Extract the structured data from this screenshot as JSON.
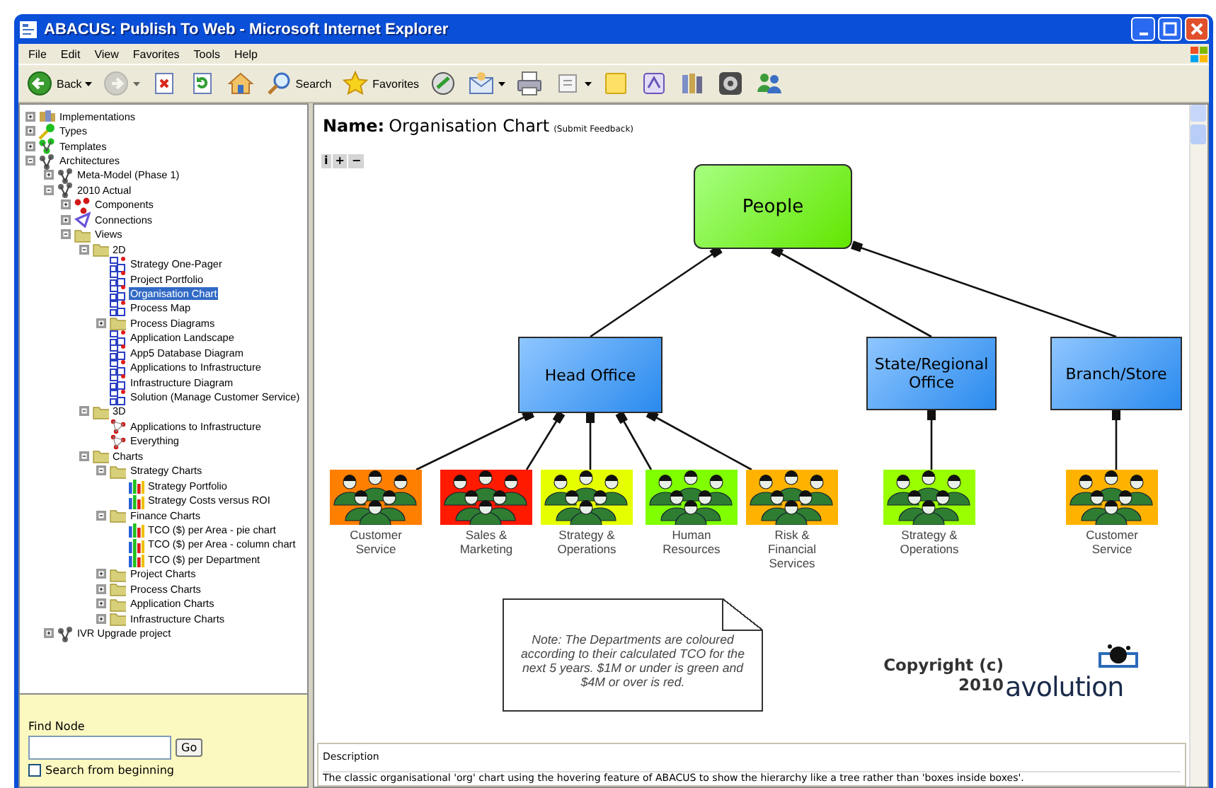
{
  "window": {
    "title": "ABACUS: Publish To Web - Microsoft Internet Explorer"
  },
  "menu": [
    "File",
    "Edit",
    "View",
    "Favorites",
    "Tools",
    "Help"
  ],
  "toolbar": [
    {
      "kind": "back",
      "label": "Back",
      "dropdown": true,
      "disabled": false
    },
    {
      "kind": "forward",
      "dropdown": true,
      "disabled": true
    },
    {
      "kind": "stop",
      "dropdown": false,
      "disabled": false
    },
    {
      "kind": "refresh",
      "dropdown": false,
      "disabled": false
    },
    {
      "kind": "home",
      "dropdown": false,
      "disabled": false
    },
    {
      "kind": "search",
      "label": "Search",
      "dropdown": false,
      "disabled": false
    },
    {
      "kind": "favorites",
      "label": "Favorites",
      "dropdown": false,
      "disabled": false
    },
    {
      "kind": "media",
      "dropdown": false,
      "disabled": false
    },
    {
      "kind": "mail",
      "dropdown": true,
      "disabled": false
    },
    {
      "kind": "print",
      "dropdown": false,
      "disabled": false
    },
    {
      "kind": "edit",
      "dropdown": true,
      "disabled": false
    },
    {
      "kind": "note",
      "dropdown": false,
      "disabled": false
    },
    {
      "kind": "research",
      "dropdown": false,
      "disabled": false
    },
    {
      "kind": "library",
      "dropdown": false,
      "disabled": false
    },
    {
      "kind": "disc",
      "dropdown": false,
      "disabled": false
    },
    {
      "kind": "messenger",
      "dropdown": false,
      "disabled": false
    }
  ],
  "tree": [
    {
      "label": "Implementations",
      "kind": "implementations",
      "expandable": true,
      "expanded": false,
      "selected": false
    },
    {
      "label": "Types",
      "kind": "types",
      "expandable": true,
      "expanded": false,
      "selected": false
    },
    {
      "label": "Templates",
      "kind": "templates",
      "expandable": true,
      "expanded": false,
      "selected": false
    },
    {
      "label": "Architectures",
      "kind": "architecture",
      "expandable": true,
      "expanded": true,
      "selected": false,
      "children": [
        {
          "label": "Meta-Model (Phase 1)",
          "kind": "architecture",
          "expandable": true,
          "expanded": false,
          "selected": false
        },
        {
          "label": "2010 Actual",
          "kind": "architecture",
          "expandable": true,
          "expanded": true,
          "selected": false,
          "children": [
            {
              "label": "Components",
              "kind": "components",
              "expandable": true,
              "expanded": false,
              "selected": false
            },
            {
              "label": "Connections",
              "kind": "connections",
              "expandable": true,
              "expanded": false,
              "selected": false
            },
            {
              "label": "Views",
              "kind": "folder",
              "expandable": true,
              "expanded": true,
              "selected": false,
              "children": [
                {
                  "label": "2D",
                  "kind": "folder",
                  "expandable": true,
                  "expanded": true,
                  "selected": false,
                  "children": [
                    {
                      "label": "Strategy One-Pager",
                      "kind": "view",
                      "expandable": false,
                      "expanded": false,
                      "selected": false
                    },
                    {
                      "label": "Project Portfolio",
                      "kind": "view",
                      "expandable": false,
                      "expanded": false,
                      "selected": false
                    },
                    {
                      "label": "Organisation Chart",
                      "kind": "view",
                      "expandable": false,
                      "expanded": false,
                      "selected": true
                    },
                    {
                      "label": "Process Map",
                      "kind": "view",
                      "expandable": false,
                      "expanded": false,
                      "selected": false
                    },
                    {
                      "label": "Process Diagrams",
                      "kind": "folder",
                      "expandable": true,
                      "expanded": false,
                      "selected": false
                    },
                    {
                      "label": "Application Landscape",
                      "kind": "view",
                      "expandable": false,
                      "expanded": false,
                      "selected": false
                    },
                    {
                      "label": "App5 Database Diagram",
                      "kind": "view",
                      "expandable": false,
                      "expanded": false,
                      "selected": false
                    },
                    {
                      "label": "Applications to Infrastructure",
                      "kind": "view",
                      "expandable": false,
                      "expanded": false,
                      "selected": false
                    },
                    {
                      "label": "Infrastructure Diagram",
                      "kind": "view",
                      "expandable": false,
                      "expanded": false,
                      "selected": false
                    },
                    {
                      "label": "Solution (Manage Customer Service)",
                      "kind": "view",
                      "expandable": false,
                      "expanded": false,
                      "selected": false
                    }
                  ]
                },
                {
                  "label": "3D",
                  "kind": "folder",
                  "expandable": true,
                  "expanded": true,
                  "selected": false,
                  "children": [
                    {
                      "label": "Applications to Infrastructure",
                      "kind": "view3d",
                      "expandable": false,
                      "expanded": false,
                      "selected": false
                    },
                    {
                      "label": "Everything",
                      "kind": "view3d",
                      "expandable": false,
                      "expanded": false,
                      "selected": false
                    }
                  ]
                },
                {
                  "label": "Charts",
                  "kind": "folder",
                  "expandable": true,
                  "expanded": true,
                  "selected": false,
                  "children": [
                    {
                      "label": "Strategy Charts",
                      "kind": "folder",
                      "expandable": true,
                      "expanded": true,
                      "selected": false,
                      "children": [
                        {
                          "label": "Strategy Portfolio",
                          "kind": "chart",
                          "expandable": false,
                          "expanded": false,
                          "selected": false
                        },
                        {
                          "label": "Strategy Costs versus ROI",
                          "kind": "chart",
                          "expandable": false,
                          "expanded": false,
                          "selected": false
                        }
                      ]
                    },
                    {
                      "label": "Finance Charts",
                      "kind": "folder",
                      "expandable": true,
                      "expanded": true,
                      "selected": false,
                      "children": [
                        {
                          "label": "TCO ($) per Area - pie chart",
                          "kind": "chart",
                          "expandable": false,
                          "expanded": false,
                          "selected": false
                        },
                        {
                          "label": "TCO ($) per Area - column chart",
                          "kind": "chart",
                          "expandable": false,
                          "expanded": false,
                          "selected": false
                        },
                        {
                          "label": "TCO ($) per Department",
                          "kind": "chart",
                          "expandable": false,
                          "expanded": false,
                          "selected": false
                        }
                      ]
                    },
                    {
                      "label": "Project Charts",
                      "kind": "folder",
                      "expandable": true,
                      "expanded": false,
                      "selected": false
                    },
                    {
                      "label": "Process Charts",
                      "kind": "folder",
                      "expandable": true,
                      "expanded": false,
                      "selected": false
                    },
                    {
                      "label": "Application Charts",
                      "kind": "folder",
                      "expandable": true,
                      "expanded": false,
                      "selected": false
                    },
                    {
                      "label": "Infrastructure Charts",
                      "kind": "folder",
                      "expandable": true,
                      "expanded": false,
                      "selected": false
                    }
                  ]
                }
              ]
            }
          ]
        },
        {
          "label": "IVR Upgrade project",
          "kind": "architecture",
          "expandable": true,
          "expanded": false,
          "selected": false
        }
      ]
    }
  ],
  "find_node": {
    "label": "Find Node",
    "button": "Go",
    "checkbox_label": "Search from beginning",
    "checked": false
  },
  "header": {
    "label": "Name:",
    "value": "Organisation Chart",
    "feedback_link": "(Submit Feedback)"
  },
  "zoom_buttons": [
    "i",
    "+",
    "−"
  ],
  "diagram": {
    "root": {
      "label": "People",
      "children": [
        {
          "label": "Head Office",
          "children": [
            {
              "label": "Customer Service",
              "color": "#ff7f00"
            },
            {
              "label": "Sales & Marketing",
              "color": "#ff1a00"
            },
            {
              "label": "Strategy & Operations",
              "color": "#e6ff00"
            },
            {
              "label": "Human Resources",
              "color": "#7fff00"
            },
            {
              "label": "Risk & Financial Services",
              "color": "#ffb300"
            }
          ]
        },
        {
          "label": "State/Regional Office",
          "children": [
            {
              "label": "Strategy & Operations",
              "color": "#99ff00"
            }
          ]
        },
        {
          "label": "Branch/Store",
          "children": [
            {
              "label": "Customer Service",
              "color": "#ffb300"
            }
          ]
        }
      ]
    },
    "note": "Note: The Departments are coloured according to their calculated TCO for the next 5 years.  $1M or under is green and $4M or over is red.",
    "copyright": "Copyright (c) 2010",
    "logo": "avolution"
  },
  "description": {
    "label": "Description",
    "text": "The classic organisational 'org' chart using the hovering feature of ABACUS to show the hierarchy like a tree rather than 'boxes inside boxes'."
  }
}
